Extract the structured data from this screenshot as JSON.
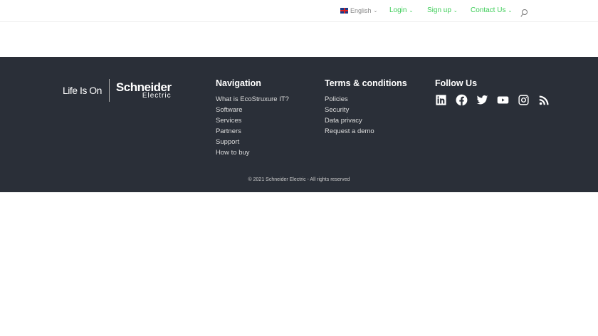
{
  "header": {
    "language": "English",
    "login": "Login",
    "signup": "Sign up",
    "contact": "Contact Us"
  },
  "footer": {
    "logo": {
      "tagline": "Life Is On",
      "brand": "Schneider",
      "brand_sub": "Electric"
    },
    "navigation": {
      "title": "Navigation",
      "items": [
        "What is EcoStruxure IT?",
        "Software",
        "Services",
        "Partners",
        "Support",
        "How to buy"
      ]
    },
    "terms": {
      "title": "Terms & conditions",
      "items": [
        "Policies",
        "Security",
        "Data privacy",
        "Request a demo"
      ]
    },
    "follow": {
      "title": "Follow Us",
      "icons": [
        "linkedin-icon",
        "facebook-icon",
        "twitter-icon",
        "youtube-icon",
        "instagram-icon",
        "rss-icon"
      ]
    },
    "copyright": "© 2021 Schneider Electric - All rights reserved"
  },
  "colors": {
    "accent": "#3dcd58",
    "footer_bg": "#2a2f38"
  }
}
